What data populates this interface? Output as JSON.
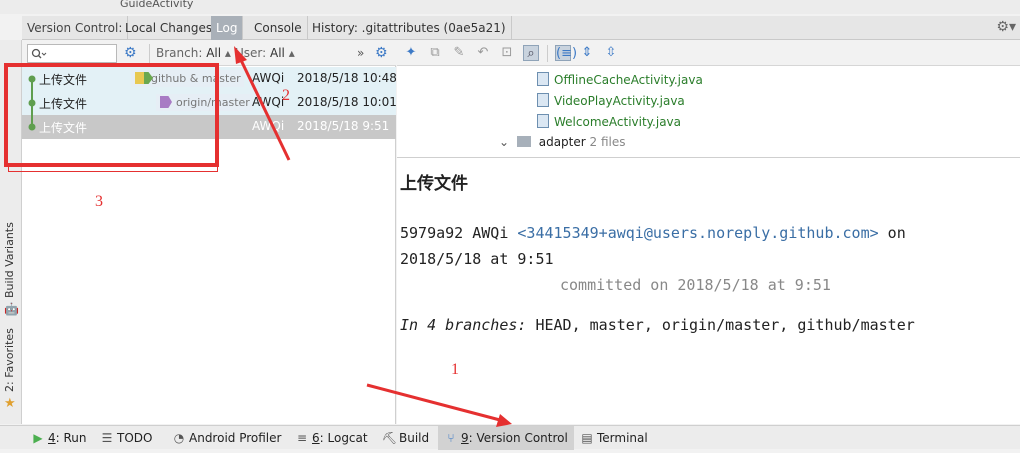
{
  "window": {
    "title": "GuideActivity"
  },
  "tabs": {
    "label": "Version Control:",
    "items": [
      "Local Changes",
      "Log",
      "Console",
      "History: .gitattributes (0ae5a21)"
    ],
    "active": "Log"
  },
  "sidebar": {
    "build_variants": "Build Variants",
    "favorites": "2: Favorites"
  },
  "log_toolbar": {
    "search_placeholder": "",
    "branch_label": "Branch:",
    "branch_value": "All",
    "user_label": "User:",
    "user_value": "All"
  },
  "commits": [
    {
      "message": "上传文件",
      "tag": "github & master",
      "author": "AWQi",
      "date": "2018/5/18 10:48"
    },
    {
      "message": "上传文件",
      "tag": "origin/master",
      "author": "AWQi",
      "date": "2018/5/18 10:01"
    },
    {
      "message": "上传文件",
      "tag": "",
      "author": "AWQi",
      "date": "2018/5/18 9:51"
    }
  ],
  "tree": {
    "files": [
      "OfflineCacheActivity.java",
      "VideoPlayActivity.java",
      "WelcomeActivity.java"
    ],
    "folder": "adapter",
    "folder_count": "2 files"
  },
  "details": {
    "subject": "上传文件",
    "hash": "5979a92",
    "author": "AWQi",
    "email": "<34415349+awqi@users.noreply.github.com>",
    "on_word": "on",
    "date": "2018/5/18 at 9:51",
    "committed": "committed on 2018/5/18 at 9:51",
    "branches_label": "In 4 branches:",
    "branches": "HEAD, master, origin/master, github/master"
  },
  "bottom_tools": [
    {
      "key": "4",
      "label": ": Run",
      "icon": "run-icon"
    },
    {
      "key": "",
      "label": "TODO",
      "icon": "todo-icon"
    },
    {
      "key": "",
      "label": "Android Profiler",
      "icon": "profiler-icon"
    },
    {
      "key": "6",
      "label": ": Logcat",
      "icon": "logcat-icon"
    },
    {
      "key": "",
      "label": "Build",
      "icon": "build-icon"
    },
    {
      "key": "9",
      "label": ": Version Control",
      "icon": "vcs-icon"
    },
    {
      "key": "",
      "label": "Terminal",
      "icon": "terminal-icon"
    }
  ],
  "annotations": {
    "a1": "1",
    "a2": "2",
    "a3": "3"
  },
  "colors": {
    "annotation": "#e53030",
    "graph": "#5f9e4f",
    "selected_row": "#c8c8c8",
    "tab_active": "#a9b0b8"
  }
}
